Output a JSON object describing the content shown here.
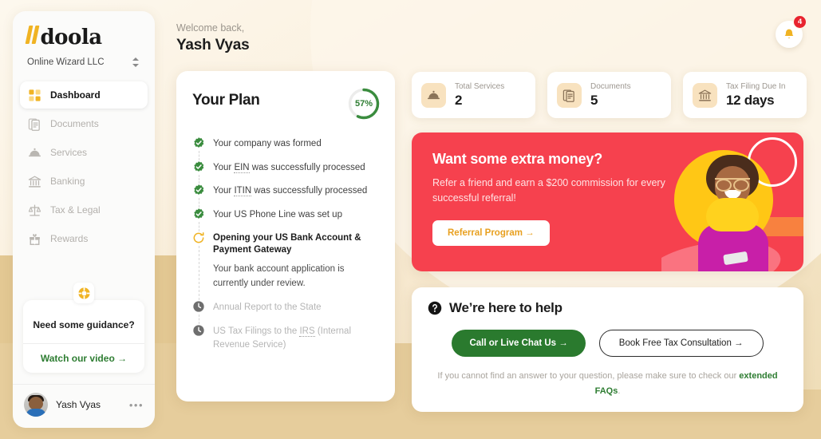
{
  "brand": {
    "bars_icon": "doola-bars-icon",
    "word": "doola"
  },
  "org": {
    "name": "Online Wizard LLC",
    "switch_icon": "chevron-updown-icon"
  },
  "sidebar": {
    "items": [
      {
        "label": "Dashboard",
        "icon": "grid-icon",
        "active": true
      },
      {
        "label": "Documents",
        "icon": "documents-icon",
        "active": false
      },
      {
        "label": "Services",
        "icon": "cloche-icon",
        "active": false
      },
      {
        "label": "Banking",
        "icon": "bank-icon",
        "active": false
      },
      {
        "label": "Tax & Legal",
        "icon": "scales-icon",
        "active": false
      },
      {
        "label": "Rewards",
        "icon": "gift-icon",
        "active": false
      }
    ],
    "guidance": {
      "icon": "lifebuoy-icon",
      "title": "Need some guidance?",
      "link": "Watch our video →"
    },
    "user": {
      "name": "Yash Vyas",
      "avatar": "avatar",
      "menu_icon": "more-dots-icon"
    }
  },
  "header": {
    "greeting": "Welcome back,",
    "name": "Yash Vyas",
    "bell_icon": "bell-icon",
    "notification_count": "4"
  },
  "plan": {
    "title": "Your Plan",
    "progress_pct": 57,
    "progress_label": "57%",
    "steps": [
      {
        "state": "done",
        "icon": "check-badge-icon",
        "text": "Your company was formed"
      },
      {
        "state": "done",
        "icon": "check-badge-icon",
        "text": "Your EIN was successfully processed",
        "abbr": "EIN"
      },
      {
        "state": "done",
        "icon": "check-badge-icon",
        "text": "Your ITIN was successfully processed",
        "abbr": "ITIN"
      },
      {
        "state": "done",
        "icon": "check-badge-icon",
        "text": "Your US Phone Line was set up"
      },
      {
        "state": "current",
        "icon": "spinner-icon",
        "text": "Opening your US Bank Account & Payment Gateway",
        "sub": "Your bank account application is currently under review."
      },
      {
        "state": "pending",
        "icon": "clock-icon",
        "text": "Annual Report to the State"
      },
      {
        "state": "pending",
        "icon": "clock-icon",
        "text": "US Tax Filings to the IRS (Internal Revenue Service)",
        "abbr": "IRS"
      }
    ]
  },
  "stats": [
    {
      "icon": "cloche-icon",
      "label": "Total Services",
      "value": "2"
    },
    {
      "icon": "documents-icon",
      "label": "Documents",
      "value": "5"
    },
    {
      "icon": "bank-icon",
      "label": "Tax Filing Due In",
      "value": "12 days"
    }
  ],
  "promo": {
    "title": "Want some extra money?",
    "subtitle": "Refer a friend and earn a $200 commission for every successful referral!",
    "button": "Referral Program →",
    "art": "woman-with-phone-illustration"
  },
  "help": {
    "icon": "question-mark-icon",
    "title": "We’re here to help",
    "primary_button": "Call or Live Chat Us →",
    "secondary_button": "Book Free Tax Consultation →",
    "note_prefix": "If you cannot find an answer to your question, please make sure to check our ",
    "note_link": "extended FAQs",
    "note_suffix": "."
  },
  "colors": {
    "brand_yellow": "#f0b323",
    "green": "#2e7d32",
    "red": "#f6414e",
    "badge_red": "#e8232f",
    "page_bg": "#f7e9d0"
  }
}
